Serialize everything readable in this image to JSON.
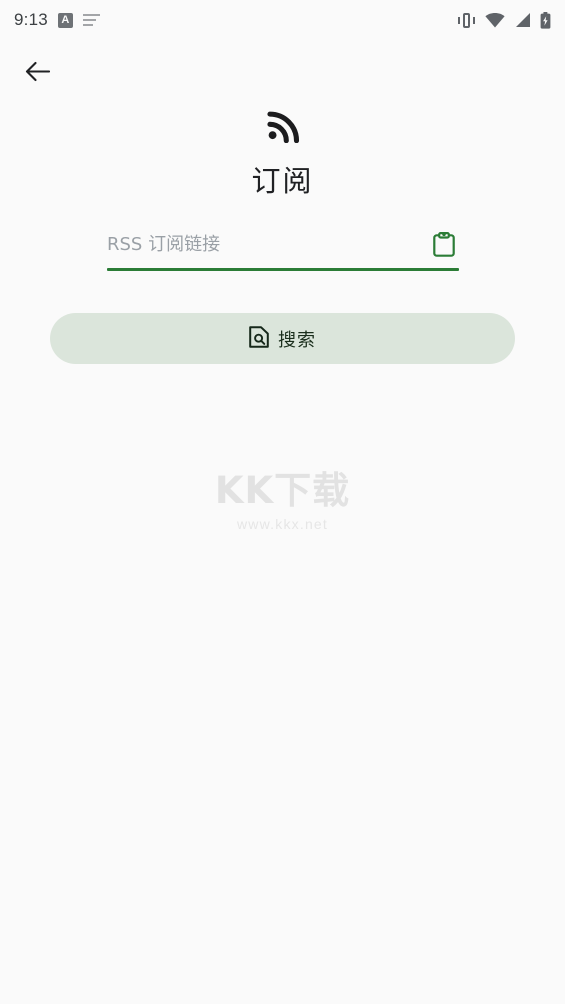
{
  "status_bar": {
    "time": "9:13",
    "left_icons": [
      {
        "name": "boxed-a-icon",
        "glyph": "A"
      },
      {
        "name": "keyboard-icon",
        "glyph": ""
      }
    ],
    "right_icons": [
      {
        "name": "vibrate-icon"
      },
      {
        "name": "wifi-icon"
      },
      {
        "name": "cellular-signal-icon"
      },
      {
        "name": "battery-charging-icon"
      }
    ]
  },
  "nav": {
    "back_label": "←"
  },
  "header": {
    "icon": "rss-feed-icon",
    "title": "订阅"
  },
  "form": {
    "input_value": "",
    "input_placeholder": "RSS 订阅链接",
    "paste_icon": "clipboard-paste-icon",
    "underline_color": "#2b7c36"
  },
  "actions": {
    "search_label": "搜索",
    "search_icon": "document-search-icon",
    "search_bg": "#dbe5db"
  },
  "watermark": {
    "logo": "KK下载",
    "url": "www.kkx.net"
  },
  "theme": {
    "background": "#fafafa",
    "accent_green": "#2b7c36",
    "text_primary": "#202124",
    "text_muted": "#9aa0a6"
  }
}
